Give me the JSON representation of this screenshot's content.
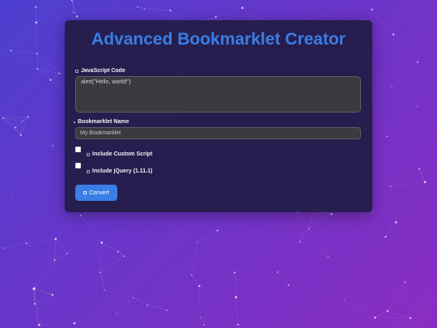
{
  "app": {
    "title": "Advanced Bookmarklet Creator"
  },
  "form": {
    "code_label": "JavaScript Code",
    "code_value": "alert(\"Hello, world!\")",
    "name_label": "Bookmarklet Name",
    "name_placeholder": "My Bookmarklet",
    "custom_script_label": "Include Custom Script",
    "custom_script_checked": false,
    "jquery_label": "Include jQuery (1.11.1)",
    "jquery_checked": false,
    "convert_label": "Convert"
  },
  "colors": {
    "accent": "#3a7ee6",
    "card_bg": "#231c48",
    "field_bg": "#3a3a3f"
  },
  "icons": {
    "code_label_icon": "code-icon",
    "name_label_icon": "bookmark-icon",
    "custom_script_icon": "file-code-icon",
    "jquery_icon": "plugin-icon",
    "convert_icon": "magic-icon"
  }
}
